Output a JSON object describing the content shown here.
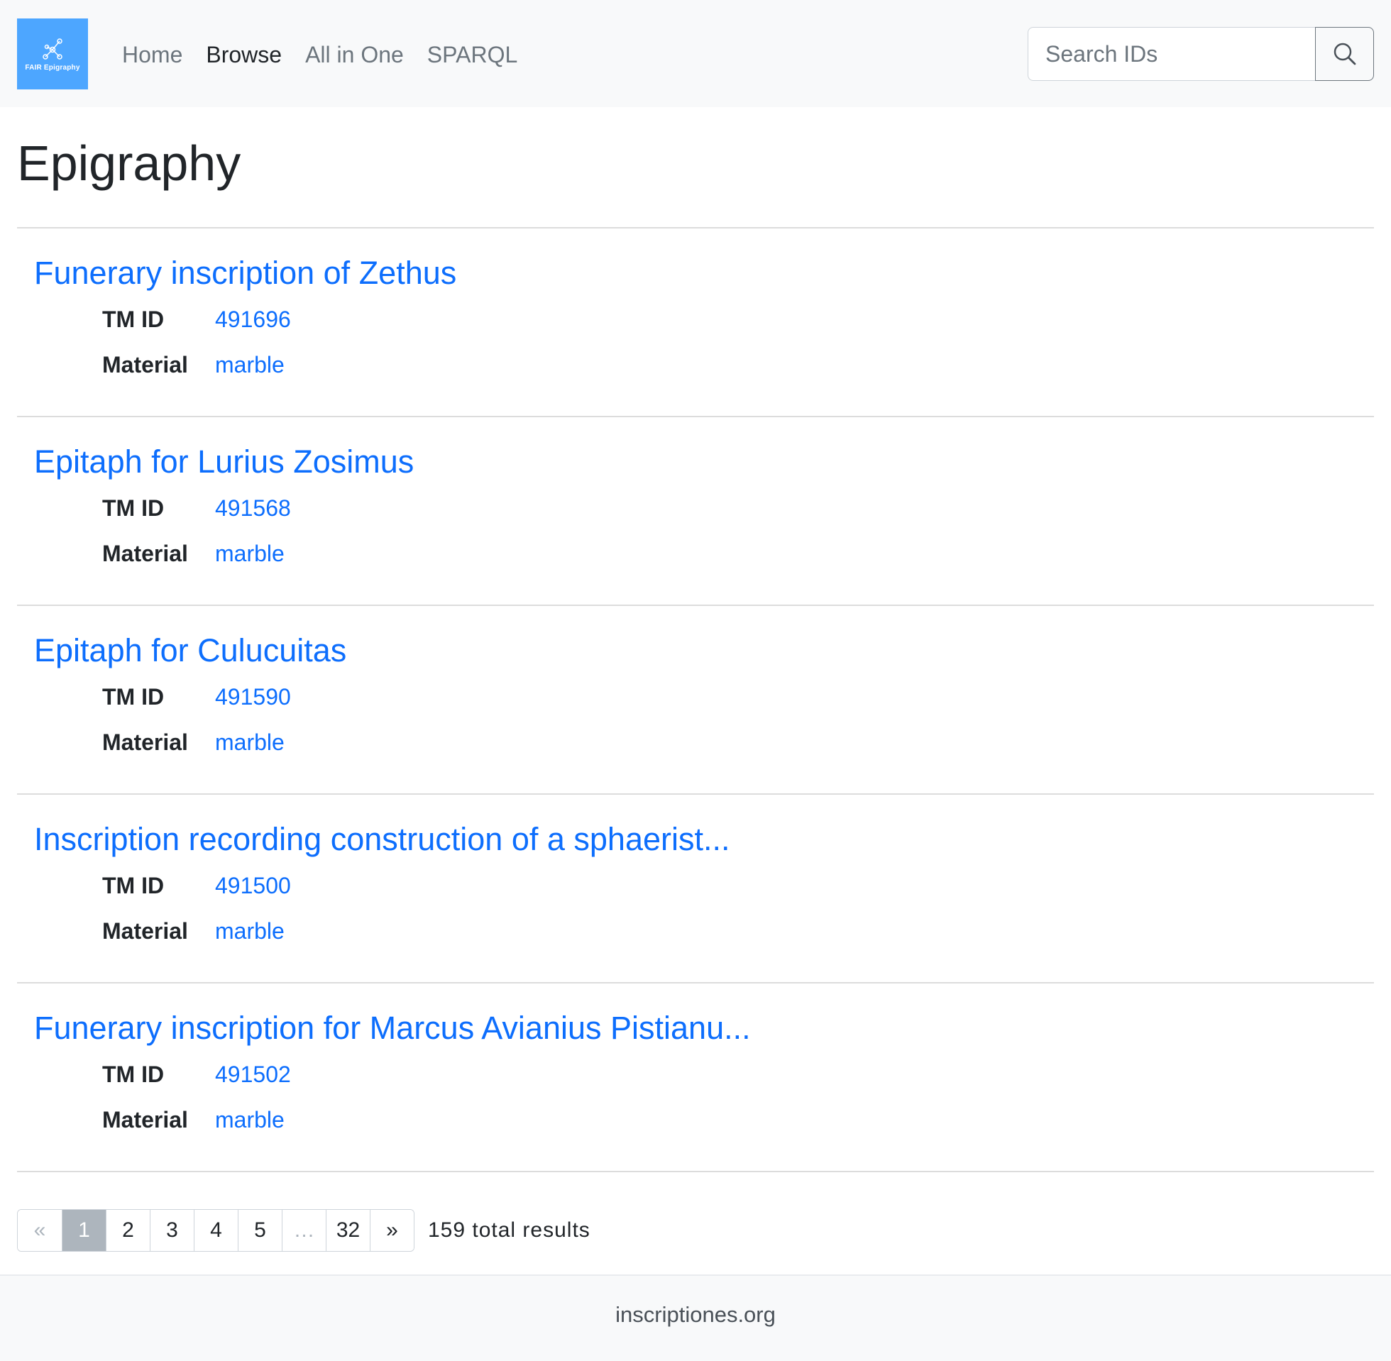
{
  "brand": {
    "logo_text": "FAIR Epigraphy",
    "color": "#4da6ff"
  },
  "nav": {
    "items": [
      {
        "label": "Home",
        "active": false
      },
      {
        "label": "Browse",
        "active": true
      },
      {
        "label": "All in One",
        "active": false
      },
      {
        "label": "SPARQL",
        "active": false
      }
    ]
  },
  "search": {
    "placeholder": "Search IDs",
    "value": "",
    "icon": "search-icon"
  },
  "page": {
    "title": "Epigraphy"
  },
  "labels": {
    "tm_id": "TM ID",
    "material": "Material"
  },
  "results": [
    {
      "title": "Funerary inscription of Zethus",
      "tm_id": "491696",
      "material": "marble"
    },
    {
      "title": "Epitaph for Lurius Zosimus",
      "tm_id": "491568",
      "material": "marble"
    },
    {
      "title": "Epitaph for Culucuitas",
      "tm_id": "491590",
      "material": "marble"
    },
    {
      "title": "Inscription recording construction of a sphaerist...",
      "tm_id": "491500",
      "material": "marble"
    },
    {
      "title": "Funerary inscription for Marcus Avianius Pistianu...",
      "tm_id": "491502",
      "material": "marble"
    }
  ],
  "pagination": {
    "prev": "«",
    "pages": [
      "1",
      "2",
      "3",
      "4",
      "5",
      "…",
      "32"
    ],
    "next": "»",
    "current": "1",
    "total_text": "159 total results"
  },
  "footer": {
    "text": "inscriptiones.org"
  },
  "colors": {
    "link": "#0d6efd",
    "navbar_bg": "#f8f9fa",
    "active_page_bg": "#adb5bd"
  }
}
